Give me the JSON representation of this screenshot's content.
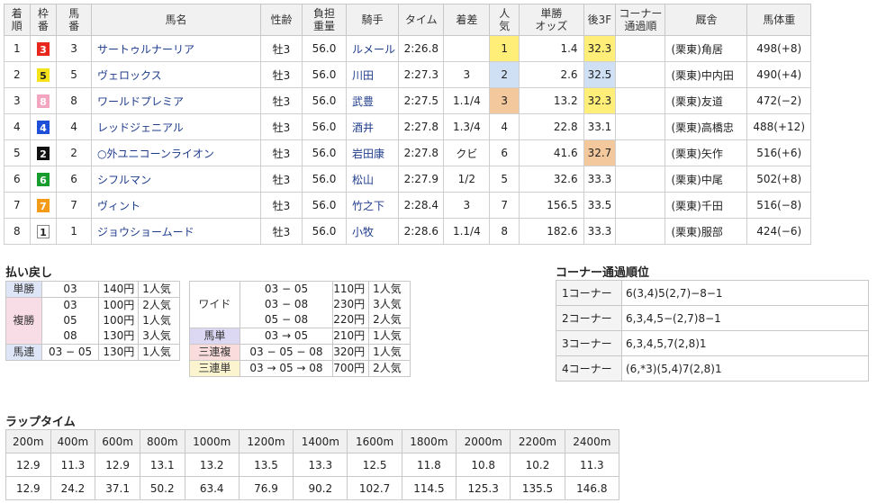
{
  "results": {
    "headers": {
      "rank": "着\n順",
      "waku": "枠\n番",
      "umaban": "馬\n番",
      "name": "馬名",
      "sexage": "性齢",
      "weight_carried": "負担\n重量",
      "jockey": "騎手",
      "time": "タイム",
      "margin": "着差",
      "popularity": "人\n気",
      "odds": "単勝\nオッズ",
      "last3f": "後3F",
      "corner": "コーナー\n通過順",
      "stable": "厩舎",
      "body_weight": "馬体重"
    },
    "rows": [
      {
        "rank": "1",
        "waku": "3",
        "umaban": "3",
        "name": "サートゥルナーリア",
        "sexage": "牡3",
        "kg": "56.0",
        "jockey": "ルメール",
        "time": "2:26.8",
        "margin": "",
        "pop": "1",
        "odds": "1.4",
        "l3f": "32.3",
        "corner": "",
        "stable": "(栗東)角居",
        "bw": "498(+8)"
      },
      {
        "rank": "2",
        "waku": "5",
        "umaban": "5",
        "name": "ヴェロックス",
        "sexage": "牡3",
        "kg": "56.0",
        "jockey": "川田",
        "time": "2:27.3",
        "margin": "3",
        "pop": "2",
        "odds": "2.6",
        "l3f": "32.5",
        "corner": "",
        "stable": "(栗東)中内田",
        "bw": "490(+4)"
      },
      {
        "rank": "3",
        "waku": "8",
        "umaban": "8",
        "name": "ワールドプレミア",
        "sexage": "牡3",
        "kg": "56.0",
        "jockey": "武豊",
        "time": "2:27.5",
        "margin": "1.1/4",
        "pop": "3",
        "odds": "13.2",
        "l3f": "32.3",
        "corner": "",
        "stable": "(栗東)友道",
        "bw": "472(−2)"
      },
      {
        "rank": "4",
        "waku": "4",
        "umaban": "4",
        "name": "レッドジェニアル",
        "sexage": "牡3",
        "kg": "56.0",
        "jockey": "酒井",
        "time": "2:27.8",
        "margin": "1.3/4",
        "pop": "4",
        "odds": "22.8",
        "l3f": "33.1",
        "corner": "",
        "stable": "(栗東)高橋忠",
        "bw": "488(+12)"
      },
      {
        "rank": "5",
        "waku": "2",
        "umaban": "2",
        "name": "○外ユニコーンライオン",
        "sexage": "牡3",
        "kg": "56.0",
        "jockey": "岩田康",
        "time": "2:27.8",
        "margin": "クビ",
        "pop": "6",
        "odds": "41.6",
        "l3f": "32.7",
        "corner": "",
        "stable": "(栗東)矢作",
        "bw": "516(+6)"
      },
      {
        "rank": "6",
        "waku": "6",
        "umaban": "6",
        "name": "シフルマン",
        "sexage": "牡3",
        "kg": "56.0",
        "jockey": "松山",
        "time": "2:27.9",
        "margin": "1/2",
        "pop": "5",
        "odds": "32.6",
        "l3f": "33.3",
        "corner": "",
        "stable": "(栗東)中尾",
        "bw": "502(+8)"
      },
      {
        "rank": "7",
        "waku": "7",
        "umaban": "7",
        "name": "ヴィント",
        "sexage": "牡3",
        "kg": "56.0",
        "jockey": "竹之下",
        "time": "2:28.4",
        "margin": "3",
        "pop": "7",
        "odds": "156.5",
        "l3f": "33.5",
        "corner": "",
        "stable": "(栗東)千田",
        "bw": "516(−8)"
      },
      {
        "rank": "8",
        "waku": "1",
        "umaban": "1",
        "name": "ジョウショームード",
        "sexage": "牡3",
        "kg": "56.0",
        "jockey": "小牧",
        "time": "2:28.6",
        "margin": "1.1/4",
        "pop": "8",
        "odds": "182.6",
        "l3f": "33.3",
        "corner": "",
        "stable": "(栗東)服部",
        "bw": "424(−6)"
      }
    ]
  },
  "payout": {
    "title": "払い戻し",
    "left": [
      {
        "label": "単勝",
        "nums": [
          "03"
        ],
        "yen": [
          "140円"
        ],
        "pop": [
          "1人気"
        ]
      },
      {
        "label": "複勝",
        "nums": [
          "03",
          "05",
          "08"
        ],
        "yen": [
          "100円",
          "100円",
          "130円"
        ],
        "pop": [
          "2人気",
          "1人気",
          "3人気"
        ]
      },
      {
        "label": "馬連",
        "nums": [
          "03 − 05"
        ],
        "yen": [
          "130円"
        ],
        "pop": [
          "1人気"
        ]
      }
    ],
    "right": [
      {
        "label": "ワイド",
        "nums": [
          "03 − 05",
          "03 − 08",
          "05 − 08"
        ],
        "yen": [
          "110円",
          "230円",
          "220円"
        ],
        "pop": [
          "1人気",
          "3人気",
          "2人気"
        ]
      },
      {
        "label": "馬単",
        "nums": [
          "03 → 05"
        ],
        "yen": [
          "210円"
        ],
        "pop": [
          "1人気"
        ]
      },
      {
        "label": "三連複",
        "nums": [
          "03 − 05 − 08"
        ],
        "yen": [
          "320円"
        ],
        "pop": [
          "1人気"
        ]
      },
      {
        "label": "三連単",
        "nums": [
          "03 → 05 → 08"
        ],
        "yen": [
          "700円"
        ],
        "pop": [
          "2人気"
        ]
      }
    ]
  },
  "corner_order": {
    "title": "コーナー通過順位",
    "rows": [
      {
        "label": "1コーナー",
        "value": "6(3,4)5(2,7)−8−1"
      },
      {
        "label": "2コーナー",
        "value": "6,3,4,5−(2,7)8−1"
      },
      {
        "label": "3コーナー",
        "value": "6,3,4,5,7(2,8)1"
      },
      {
        "label": "4コーナー",
        "value": "(6,*3)(5,4)7(2,8)1"
      }
    ]
  },
  "lap": {
    "title": "ラップタイム",
    "distances": [
      "200m",
      "400m",
      "600m",
      "800m",
      "1000m",
      "1200m",
      "1400m",
      "1600m",
      "1800m",
      "2000m",
      "2200m",
      "2400m"
    ],
    "laps": [
      "12.9",
      "11.3",
      "12.9",
      "13.1",
      "13.2",
      "13.5",
      "13.3",
      "12.5",
      "11.8",
      "10.8",
      "10.2",
      "11.3"
    ],
    "cumulative": [
      "12.9",
      "24.2",
      "37.1",
      "50.2",
      "63.4",
      "76.9",
      "90.2",
      "102.7",
      "114.5",
      "125.3",
      "135.5",
      "146.8"
    ]
  },
  "colors": {
    "waku": {
      "1": [
        "#ffffff",
        "#222222"
      ],
      "2": [
        "#111111",
        "#ffffff"
      ],
      "3": [
        "#e8261c",
        "#ffffff"
      ],
      "4": [
        "#1e4fd8",
        "#ffffff"
      ],
      "5": [
        "#f5e21a",
        "#222222"
      ],
      "6": [
        "#179c2e",
        "#ffffff"
      ],
      "7": [
        "#f39a17",
        "#ffffff"
      ],
      "8": [
        "#f4a5c0",
        "#ffffff"
      ]
    },
    "payout_labels": {
      "単勝": "#dde5f7",
      "複勝": "#f9dde6",
      "馬連": "#dde5f7",
      "ワイド": "#ffffff",
      "馬単": "#dcd7f2",
      "三連複": "#fadcdc",
      "三連単": "#fbf4cf"
    }
  }
}
